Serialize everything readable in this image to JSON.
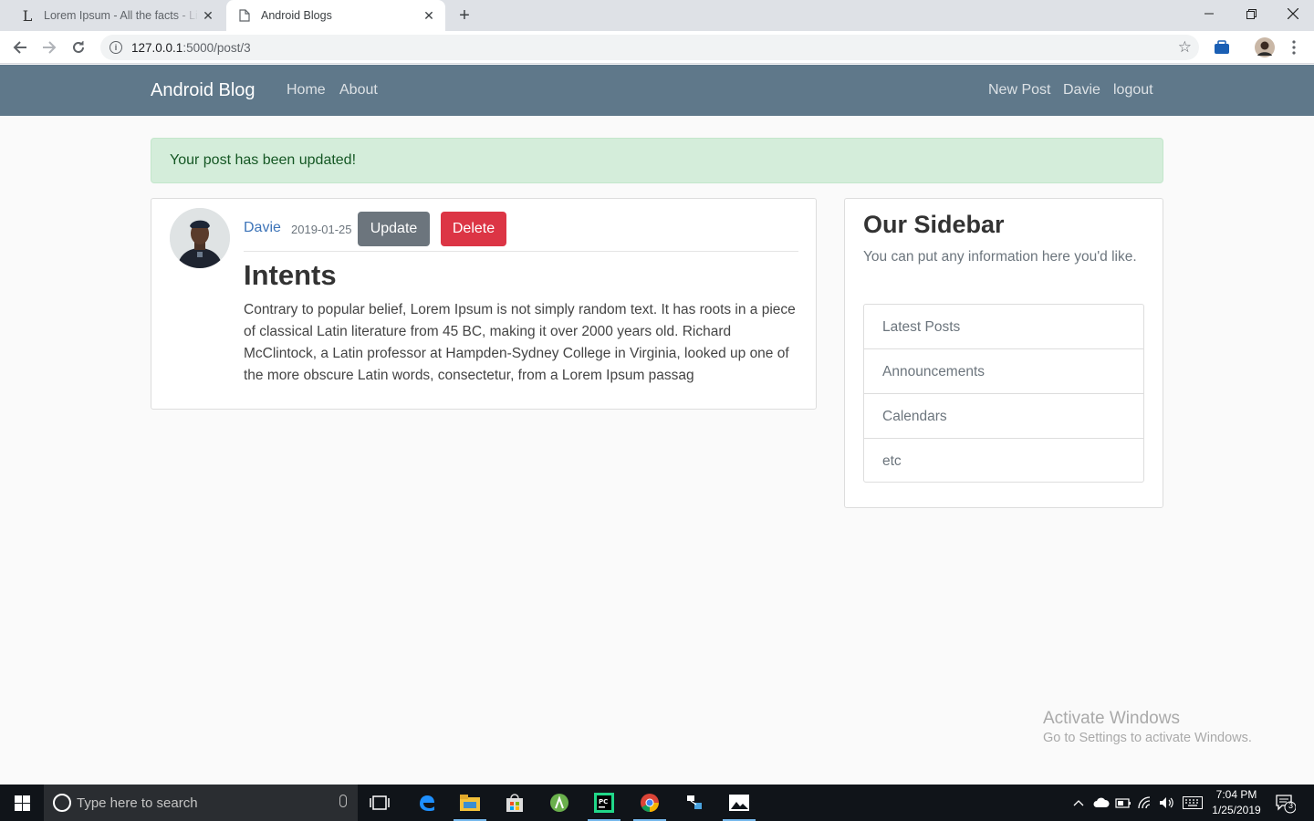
{
  "browser": {
    "tabs": [
      {
        "label": "Lorem Ipsum - All the facts - Lipsum"
      },
      {
        "label": "Android Blogs"
      }
    ],
    "url_host": "127.0.0.1",
    "url_path": ":5000/post/3"
  },
  "navbar": {
    "brand": "Android Blog",
    "left_links": [
      "Home",
      "About"
    ],
    "right_links": [
      "New Post",
      "Davie",
      "logout"
    ]
  },
  "alert": {
    "message": "Your post has been updated!"
  },
  "post": {
    "author": "Davie",
    "date": "2019-01-25",
    "update_label": "Update",
    "delete_label": "Delete",
    "title": "Intents",
    "content": "Contrary to popular belief, Lorem Ipsum is not simply random text. It has roots in a piece of classical Latin literature from 45 BC, making it over 2000 years old. Richard McClintock, a Latin professor at Hampden-Sydney College in Virginia, looked up one of the more obscure Latin words, consectetur, from a Lorem Ipsum passag"
  },
  "sidebar": {
    "title": "Our Sidebar",
    "text": "You can put any information here you'd like.",
    "items": [
      "Latest Posts",
      "Announcements",
      "Calendars",
      "etc"
    ]
  },
  "watermark": {
    "line1": "Activate Windows",
    "line2": "Go to Settings to activate Windows."
  },
  "taskbar": {
    "search_placeholder": "Type here to search",
    "time": "7:04 PM",
    "date": "1/25/2019",
    "notification_count": "3"
  },
  "colors": {
    "navbar": "#5f788a",
    "alert_bg": "#d4edda",
    "alert_text": "#155724",
    "update_button": "#6c757d",
    "delete_button": "#dc3545",
    "link": "#3d74b8"
  }
}
